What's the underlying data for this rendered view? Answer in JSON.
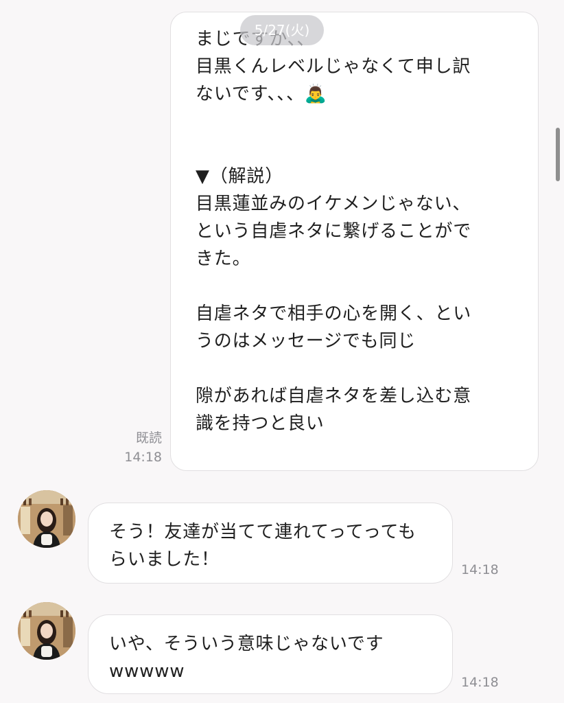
{
  "date_header": "5/27(火)",
  "outgoing": {
    "text": "まじですか、、\n目黒くんレベルじゃなくて申し訳\nないです、、、🙇‍♂️\n\n\n▼（解説）\n目黒蓮並みのイケメンじゃない、\nという自虐ネタに繋げることがで\nきた。\n\n自虐ネタで相手の心を開く、とい\nうのはメッセージでも同じ\n\n隙があれば自虐ネタを差し込む意\n識を持つと良い",
    "read_label": "既読",
    "time": "14:18"
  },
  "incoming": [
    {
      "text": "そう！友達が当てて連れてってっても\nらいました！",
      "time": "14:18"
    },
    {
      "text": "いや、そういう意味じゃないです\nwwwww",
      "time": "14:18"
    }
  ],
  "colors": {
    "background": "#f9f7f8",
    "bubble": "#ffffff",
    "bubble_border": "#e1dfe1",
    "meta_text": "#8e8e93"
  }
}
